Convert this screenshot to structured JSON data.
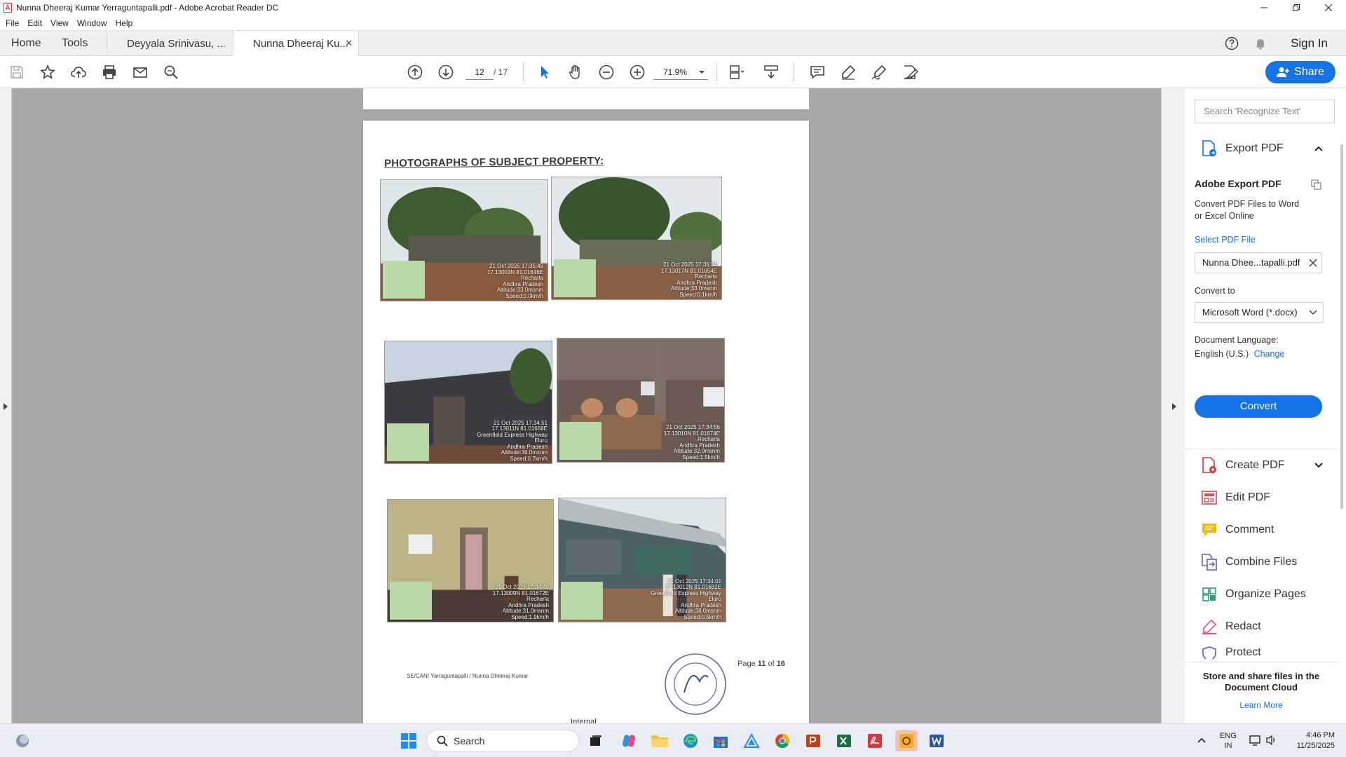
{
  "window": {
    "title": "Nunna Dheeraj Kumar Yerraguntapalli.pdf - Adobe Acrobat Reader DC"
  },
  "menu": [
    "File",
    "Edit",
    "View",
    "Window",
    "Help"
  ],
  "tabs": {
    "home": "Home",
    "tools": "Tools",
    "doc1": "Deyyala Srinivasu, ...",
    "doc2": "Nunna Dheeraj Ku...",
    "signin": "Sign In"
  },
  "toolbar": {
    "page_current": "12",
    "page_total": "/ 17",
    "zoom": "71.9%",
    "share": "Share"
  },
  "document": {
    "heading": "PHOTOGRAPHS OF SUBJECT PROPERTY:",
    "photos": [
      {
        "overlay": [
          "21 Oct 2025 17:35:49",
          "17.13003N 81.01646E",
          "Recharla",
          "Andhra Pradesh",
          "Altitude:33.0msnm",
          "Speed:0.0km/h"
        ]
      },
      {
        "overlay": [
          "21 Oct 2025 17:35:34",
          "17.13017N 81.01654E",
          "Recharla",
          "Andhra Pradesh",
          "Altitude:33.0msnm",
          "Speed:0.1km/h"
        ]
      },
      {
        "overlay": [
          "21 Oct 2025 17:34:51",
          "17.13011N 81.01668E",
          "Greenfield Express Highway",
          "Eluru",
          "Andhra Pradesh",
          "Altitude:36.0msnm",
          "Speed:0.7km/h"
        ]
      },
      {
        "overlay": [
          "21 Oct 2025 17:34:56",
          "17.13010N 81.01674E",
          "Recharla",
          "Andhra Pradesh",
          "Altitude:32.0msnm",
          "Speed:1.5km/h"
        ]
      },
      {
        "overlay": [
          "21 Oct 2025 17:34:49",
          "17.13009N 81.01672E",
          "Recharla",
          "Andhra Pradesh",
          "Altitude:31.0msnm",
          "Speed:1.9km/h"
        ]
      },
      {
        "overlay": [
          "21 Oct 2025 17:34:01",
          "17.13012N 81.01682E",
          "Greenfield Express Highway",
          "Eluru",
          "Andhra Pradesh",
          "Altitude:38.0msnm",
          "Speed:0.5km/h"
        ]
      }
    ],
    "footer_left": "SE/CAN/ Yarraguntapalli / Nunna Dheeraj Kumar",
    "footer_page_prefix": "Page ",
    "footer_page_num": "11",
    "footer_page_mid": " of ",
    "footer_page_total": "16",
    "footer_internal": "Internal"
  },
  "right_panel": {
    "search_placeholder": "Search 'Recognize Text'",
    "export_header": "Export PDF",
    "adobe_export_title": "Adobe Export PDF",
    "adobe_export_desc_1": "Convert PDF Files to Word",
    "adobe_export_desc_2": "or Excel Online",
    "select_file": "Select PDF File",
    "file_name": "Nunna Dhee...tapalli.pdf",
    "convert_to_label": "Convert to",
    "convert_to_value": "Microsoft Word (*.docx)",
    "doc_language_label": "Document Language:",
    "doc_language_value": "English (U.S.)",
    "change": "Change",
    "convert_btn": "Convert",
    "tools": [
      "Create PDF",
      "Edit PDF",
      "Comment",
      "Combine Files",
      "Organize Pages",
      "Redact",
      "Protect"
    ],
    "cloud_title_1": "Store and share files in the",
    "cloud_title_2": "Document Cloud",
    "learn_more": "Learn More"
  },
  "taskbar": {
    "search": "Search",
    "lang_1": "ENG",
    "lang_2": "IN",
    "time": "4:46 PM",
    "date": "11/25/2025"
  },
  "colors": {
    "accent": "#1473e6",
    "viewer_bg": "#a8a8a8",
    "pdf_red": "#d7373f"
  }
}
